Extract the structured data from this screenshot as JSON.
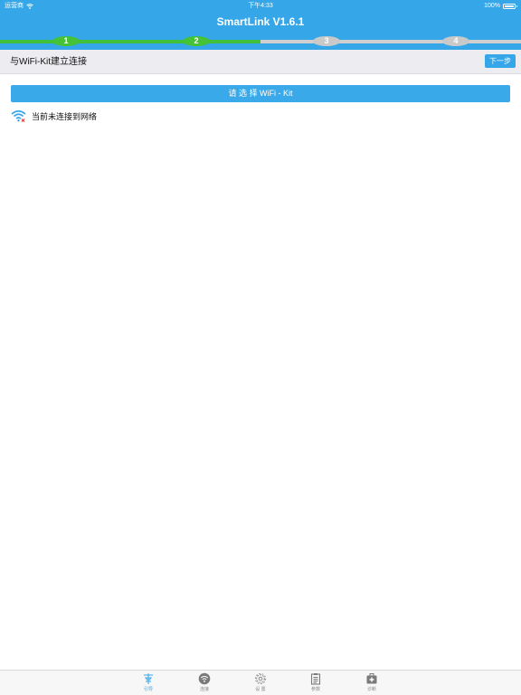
{
  "status_bar": {
    "carrier": "运营商",
    "time": "下午4:33",
    "battery": "100%"
  },
  "header": {
    "title": "SmartLink V1.6.1"
  },
  "progress": {
    "steps": [
      "1",
      "2",
      "3",
      "4"
    ],
    "completed_steps": 2
  },
  "subheader": {
    "title": "与WiFi-Kit建立连接",
    "next_label": "下一步"
  },
  "main": {
    "select_button_label": "请 选 择 WiFi - Kit",
    "network_status": "当前未连接到网络"
  },
  "tabbar": {
    "items": [
      {
        "label": "引导",
        "icon": "guide-icon",
        "active": true
      },
      {
        "label": "连接",
        "icon": "wifi-icon",
        "active": false
      },
      {
        "label": "设 置",
        "icon": "gear-icon",
        "active": false
      },
      {
        "label": "参数",
        "icon": "clipboard-icon",
        "active": false
      },
      {
        "label": "诊断",
        "icon": "medical-kit-icon",
        "active": false
      }
    ]
  },
  "colors": {
    "accent": "#35a6e8",
    "progress_done": "#45c238",
    "progress_todo": "#c9c9c9"
  }
}
